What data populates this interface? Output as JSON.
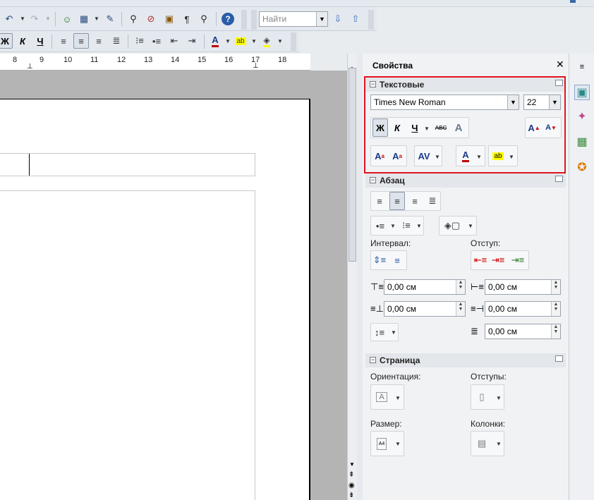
{
  "toolbar": {
    "search_placeholder": "Найти"
  },
  "ruler": {
    "ticks": [
      "8",
      "9",
      "10",
      "11",
      "12",
      "13",
      "14",
      "15",
      "16",
      "17",
      "18"
    ]
  },
  "sidebar": {
    "title": "Свойства",
    "text_section": {
      "title": "Текстовые",
      "font_name": "Times New Roman",
      "font_size": "22",
      "bold_label": "Ж",
      "italic_label": "К",
      "underline_label": "Ч",
      "strike_label": "ABC"
    },
    "paragraph_section": {
      "title": "Абзац",
      "spacing_label": "Интервал:",
      "indent_label": "Отступ:",
      "above_value": "0,00 см",
      "below_value": "0,00 см",
      "before_text_value": "0,00 см",
      "after_text_value": "0,00 см",
      "first_line_value": "0,00 см"
    },
    "page_section": {
      "title": "Страница",
      "orientation_label": "Ориентация:",
      "margins_label": "Отступы:",
      "size_label": "Размер:",
      "columns_label": "Колонки:",
      "size_icon_text": "A4"
    }
  },
  "colors": {
    "highlight_frame": "#e0151f",
    "font_color": "#c00000",
    "highlight_color": "#ffff00"
  }
}
